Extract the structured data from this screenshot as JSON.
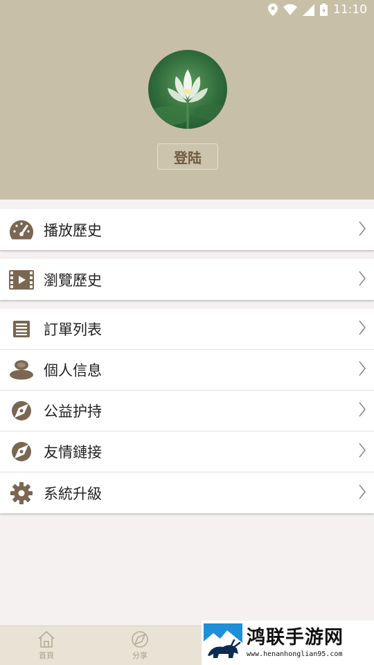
{
  "status_bar": {
    "time": "11:10"
  },
  "profile": {
    "login_label": "登陆"
  },
  "menu_groups": [
    {
      "items": [
        {
          "label": "播放歷史",
          "icon": "speedometer-icon"
        }
      ]
    },
    {
      "items": [
        {
          "label": "瀏覽歷史",
          "icon": "film-icon"
        }
      ]
    },
    {
      "items": [
        {
          "label": "訂單列表",
          "icon": "list-icon"
        },
        {
          "label": "個人信息",
          "icon": "person-icon"
        },
        {
          "label": "公益护持",
          "icon": "compass-icon"
        },
        {
          "label": "友情鏈接",
          "icon": "compass-icon"
        },
        {
          "label": "系統升級",
          "icon": "gear-icon"
        }
      ]
    }
  ],
  "tabs": [
    {
      "label": "首頁",
      "icon": "home-icon"
    },
    {
      "label": "分享",
      "icon": "share-icon"
    }
  ],
  "watermark": {
    "title": "鸿联手游网",
    "url": "www.henanhonglian95.com"
  },
  "colors": {
    "header_bg": "#c8bfa7",
    "icon_brown": "#7a6651",
    "page_bg": "#f4f1f0"
  }
}
